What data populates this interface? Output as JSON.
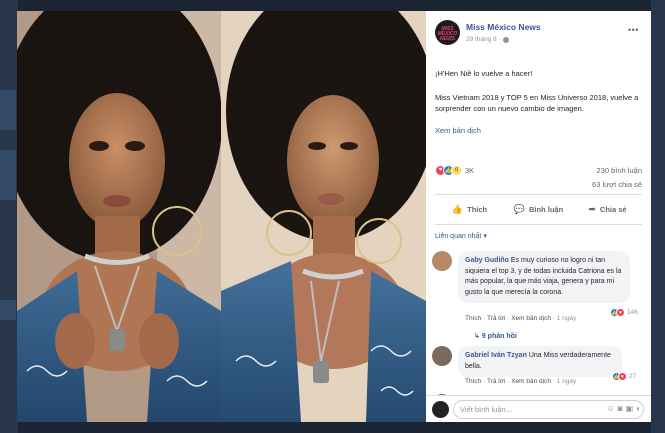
{
  "post": {
    "page_name": "Miss México News",
    "avatar_text": "MISS MEXICO NEWS",
    "date": "29 tháng 8",
    "separator": "·",
    "more": "•••",
    "line1": "¡H'Hen Niê lo vuelve a hacer!",
    "line2": "Miss Vietnam 2018 y TOP 5 en Miss Universo 2018, vuelve a sorprender con un nuevo cambio de imagen.",
    "translate": "Xem bản dịch"
  },
  "stats": {
    "reactions": "3K",
    "comments": "230 bình luận",
    "shares": "63 lượt chia sẻ"
  },
  "actions": {
    "like": "Thích",
    "comment": "Bình luận",
    "share": "Chia sẻ"
  },
  "relevance": "Liên quan nhất",
  "comments": [
    {
      "author": "Gaby Gudiño",
      "text": "Es muy curioso no logro ni tan siquiera el top 3, y de todas incluida Catriona es la más popular, la que más viaja, genera y para mi gusto la que merecía la corona.",
      "like": "Thích",
      "reply": "Trả lời",
      "translate": "Xem bản dịch",
      "time": "1 ngày",
      "reactions": "146",
      "replies": "9 phản hồi"
    },
    {
      "author": "Gabriel Iván Tzyan",
      "text": "Una Miss verdaderamente bella.",
      "like": "Thích",
      "reply": "Trả lời",
      "translate": "Xem bản dịch",
      "time": "1 ngày",
      "reactions": "27"
    }
  ],
  "comment_box": {
    "placeholder": "Viết bình luận..."
  },
  "icons": {
    "globe": "globe-icon",
    "like": "thumbs-up-icon",
    "comment": "speech-bubble-icon",
    "share": "share-arrow-icon",
    "emoji": "smiley-icon",
    "camera": "camera-icon",
    "gif": "gif-icon",
    "sticker": "sticker-icon"
  },
  "colors": {
    "link": "#365899",
    "love": "#f33e58",
    "like": "#1877f2",
    "wow": "#fcd862"
  }
}
